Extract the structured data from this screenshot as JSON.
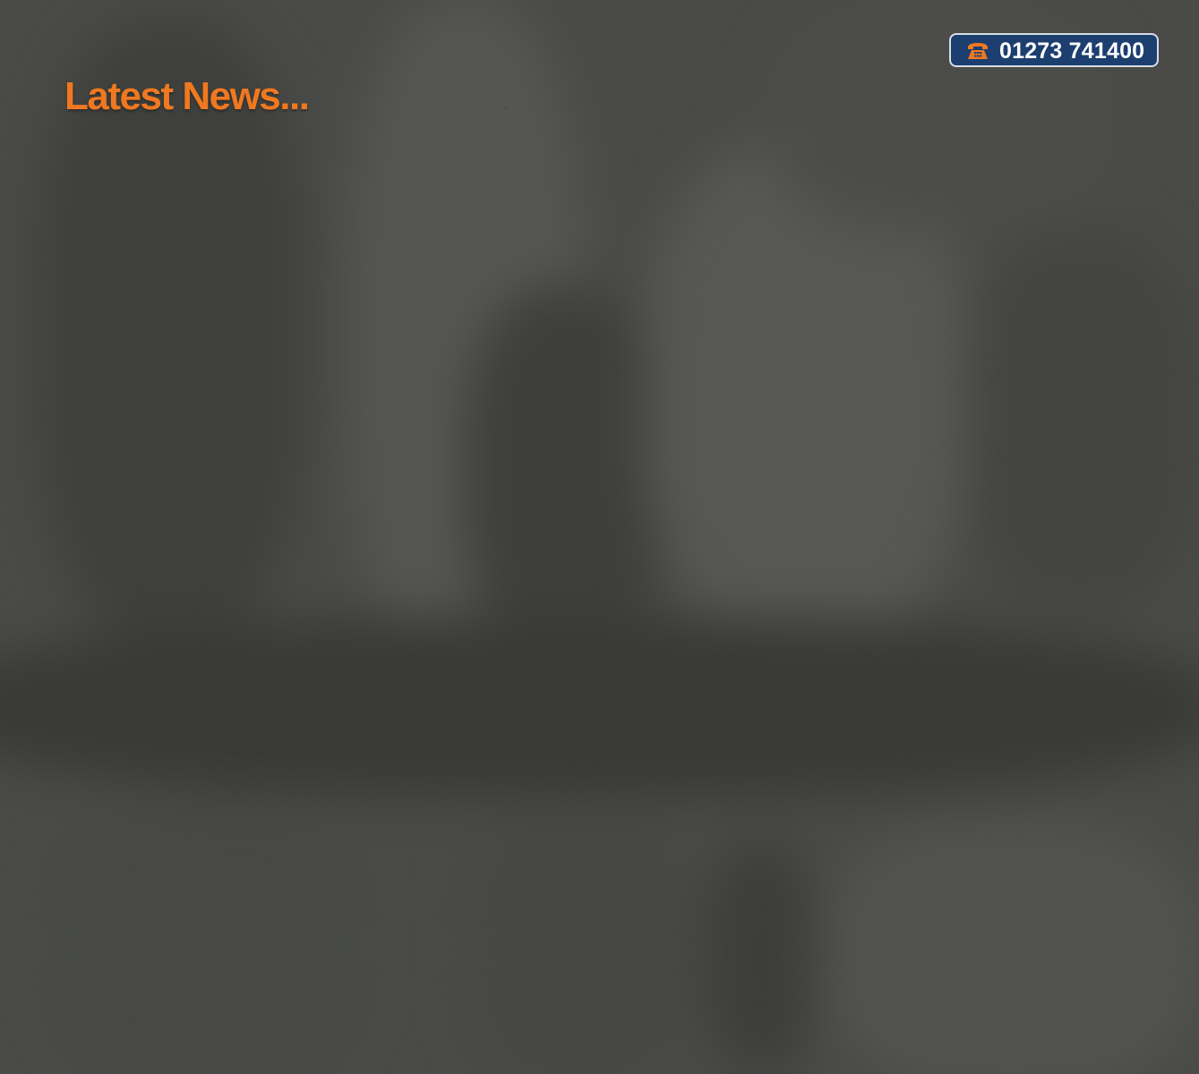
{
  "header": {
    "phone": {
      "number": "01273 741400",
      "icon": "phone-icon"
    }
  },
  "main": {
    "headline": "Latest News..."
  },
  "colors": {
    "accent": "#f07820",
    "badge_background": "#1c3f70",
    "badge_border": "#d8dde6",
    "background": "#474845"
  }
}
